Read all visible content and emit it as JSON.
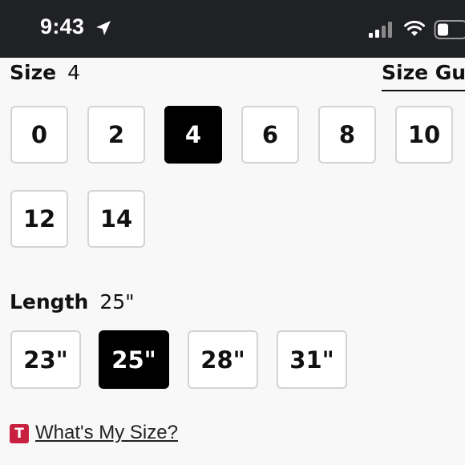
{
  "status_bar": {
    "time": "9:43",
    "icons": [
      "location-arrow-icon",
      "cellular-signal-icon",
      "wifi-icon",
      "battery-icon"
    ]
  },
  "size": {
    "label": "Size",
    "selected_value": "4",
    "guide_label": "Size Gui",
    "options": [
      "0",
      "2",
      "4",
      "6",
      "8",
      "10",
      "12",
      "14"
    ]
  },
  "length": {
    "label": "Length",
    "selected_value": "25\"",
    "options": [
      "23\"",
      "25\"",
      "28\"",
      "31\""
    ]
  },
  "fit_tool": {
    "badge_text": "T",
    "link_label": "What's My Size?"
  },
  "colors": {
    "status_bar_bg": "#202124",
    "selected_option_bg": "#000000",
    "option_border": "#d4d4d4",
    "page_bg": "#f8f8f8",
    "brand_badge": "#c8203f"
  }
}
